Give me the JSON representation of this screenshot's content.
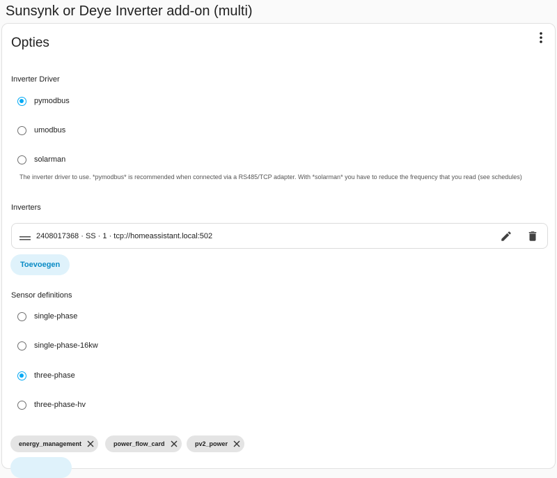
{
  "page": {
    "title": "Sunsynk or Deye Inverter add-on (multi)"
  },
  "card": {
    "title": "Opties",
    "menu_icon": "more-vert-icon",
    "inverter_driver": {
      "label": "Inverter Driver",
      "options": [
        {
          "label": "pymodbus",
          "checked": true
        },
        {
          "label": "umodbus",
          "checked": false
        },
        {
          "label": "solarman",
          "checked": false
        }
      ],
      "helper": "The inverter driver to use. *pymodbus* is recommended when connected via a RS485/TCP adapter. With *solarman* you have to reduce the frequency that you read (see schedules)"
    },
    "inverters": {
      "label": "Inverters",
      "items": [
        {
          "text": "2408017368 · SS · 1 · tcp://homeassistant.local:502",
          "edit_icon": "pencil-icon",
          "delete_icon": "trash-icon"
        }
      ],
      "add_label": "Toevoegen"
    },
    "sensor_definitions": {
      "label": "Sensor definitions",
      "options": [
        {
          "label": "single-phase",
          "checked": false
        },
        {
          "label": "single-phase-16kw",
          "checked": false
        },
        {
          "label": "three-phase",
          "checked": true
        },
        {
          "label": "three-phase-hv",
          "checked": false
        }
      ]
    },
    "sensors": {
      "chips": [
        "energy_management",
        "power_flow_card",
        "pv2_power"
      ]
    }
  },
  "colors": {
    "accent": "#03a9f4",
    "accent_bg": "#dff2fb",
    "chip_bg": "#e4e4e4"
  }
}
